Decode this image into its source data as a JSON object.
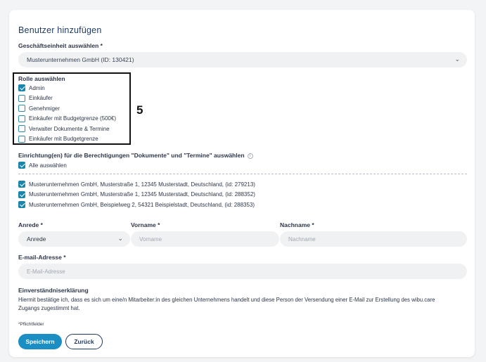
{
  "form": {
    "title": "Benutzer hinzufügen",
    "business_unit": {
      "label": "Geschäftseinheit auswählen *",
      "value": "Musterunternehmen GmbH (ID: 130421)"
    },
    "roles": {
      "label": "Rolle auswählen",
      "items": [
        {
          "label": "Admin",
          "checked": true
        },
        {
          "label": "Einkäufer",
          "checked": false
        },
        {
          "label": "Genehmiger",
          "checked": false
        },
        {
          "label": "Einkäufer mit Budgetgrenze (500€)",
          "checked": false
        },
        {
          "label": "Verwalter Dokumente & Termine",
          "checked": false
        },
        {
          "label": "Einkäufer mit Budgetgrenze",
          "checked": false
        }
      ]
    },
    "annotation_badge": "5",
    "facilities": {
      "label": "Einrichtung(en) für die Berechtigungen \"Dokumente\" und \"Termine\" auswählen",
      "info_icon": "i",
      "select_all": {
        "label": "Alle auswählen",
        "checked": true
      },
      "items": [
        {
          "label": "Musterunternehmen GmbH, Musterstraße 1, 12345 Musterstadt, Deutschland, (id: 279213)",
          "checked": true
        },
        {
          "label": "Musterunternehmen GmbH, Musterstraße 1, 12345 Musterstadt, Deutschland, (id: 288352)",
          "checked": true
        },
        {
          "label": "Musterunternehmen GmbH, Beispielweg 2, 54321 Beispielstadt, Deutschland, (id: 288353)",
          "checked": true
        }
      ]
    },
    "salutation": {
      "label": "Anrede *",
      "value": "Anrede"
    },
    "firstname": {
      "label": "Vorname *",
      "placeholder": "Vorname"
    },
    "lastname": {
      "label": "Nachname *",
      "placeholder": "Nachname"
    },
    "email": {
      "label": "E-mail-Adresse *",
      "placeholder": "E-Mail-Adresse"
    },
    "consent": {
      "title": "Einverständniserklärung",
      "text": "Hiermit bestätige ich, dass es sich um eine/n Mitarbeiter:in des gleichen Unternehmens handelt und diese Person der Versendung einer E-Mail zur Erstellung des wibu.care Zugangs zugestimmt hat."
    },
    "required_note": "*Pflichtfelder",
    "save_label": "Speichern",
    "back_label": "Zurück"
  },
  "colors": {
    "primary": "#1b8fc4",
    "checkbox": "#1b86ad",
    "title": "#1f3a5f"
  }
}
